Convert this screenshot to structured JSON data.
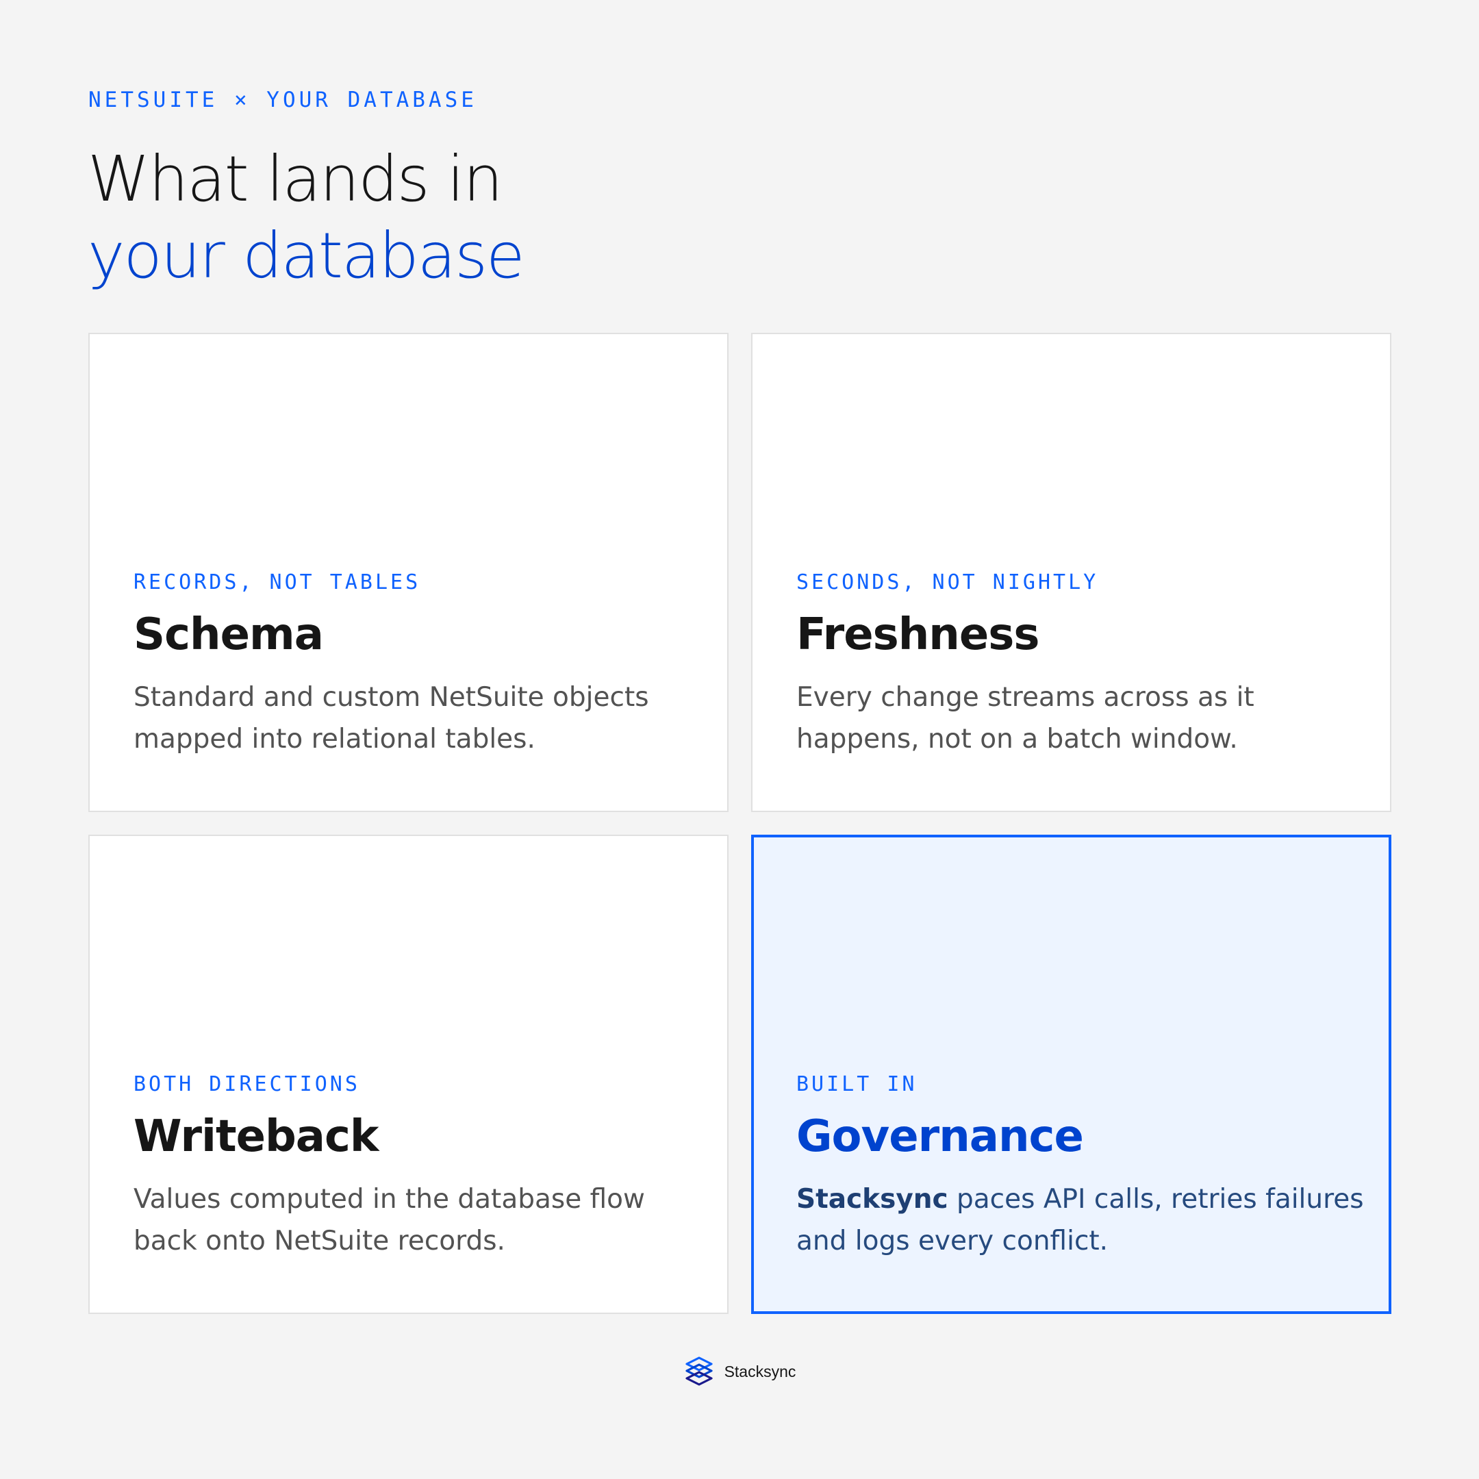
{
  "header": {
    "eyebrow": "NETSUITE × YOUR DATABASE",
    "title_line1": "What lands in",
    "title_line2": "your database"
  },
  "cards": [
    {
      "kicker": "RECORDS, NOT TABLES",
      "title": "Schema",
      "description": "Standard and custom NetSuite objects mapped into relational tables."
    },
    {
      "kicker": "SECONDS, NOT NIGHTLY",
      "title": "Freshness",
      "description": "Every change streams across as it happens, not on a batch window."
    },
    {
      "kicker": "BOTH DIRECTIONS",
      "title": "Writeback",
      "description": "Values computed in the database flow back onto NetSuite records."
    },
    {
      "kicker": "BUILT IN",
      "title": "Governance",
      "brand": "Stacksync",
      "description": " paces API calls, retries failures and logs every conflict.",
      "highlighted": true
    }
  ],
  "footer": {
    "logo_icon": "stacksync-logo-icon",
    "brand_name": "Stacksync"
  },
  "colors": {
    "accent": "#0f62fe",
    "accent_dark": "#0043ce",
    "background": "#f4f4f4",
    "card": "#ffffff",
    "highlight_card": "#edf4ff",
    "text": "#161616",
    "muted_text": "#525252"
  }
}
